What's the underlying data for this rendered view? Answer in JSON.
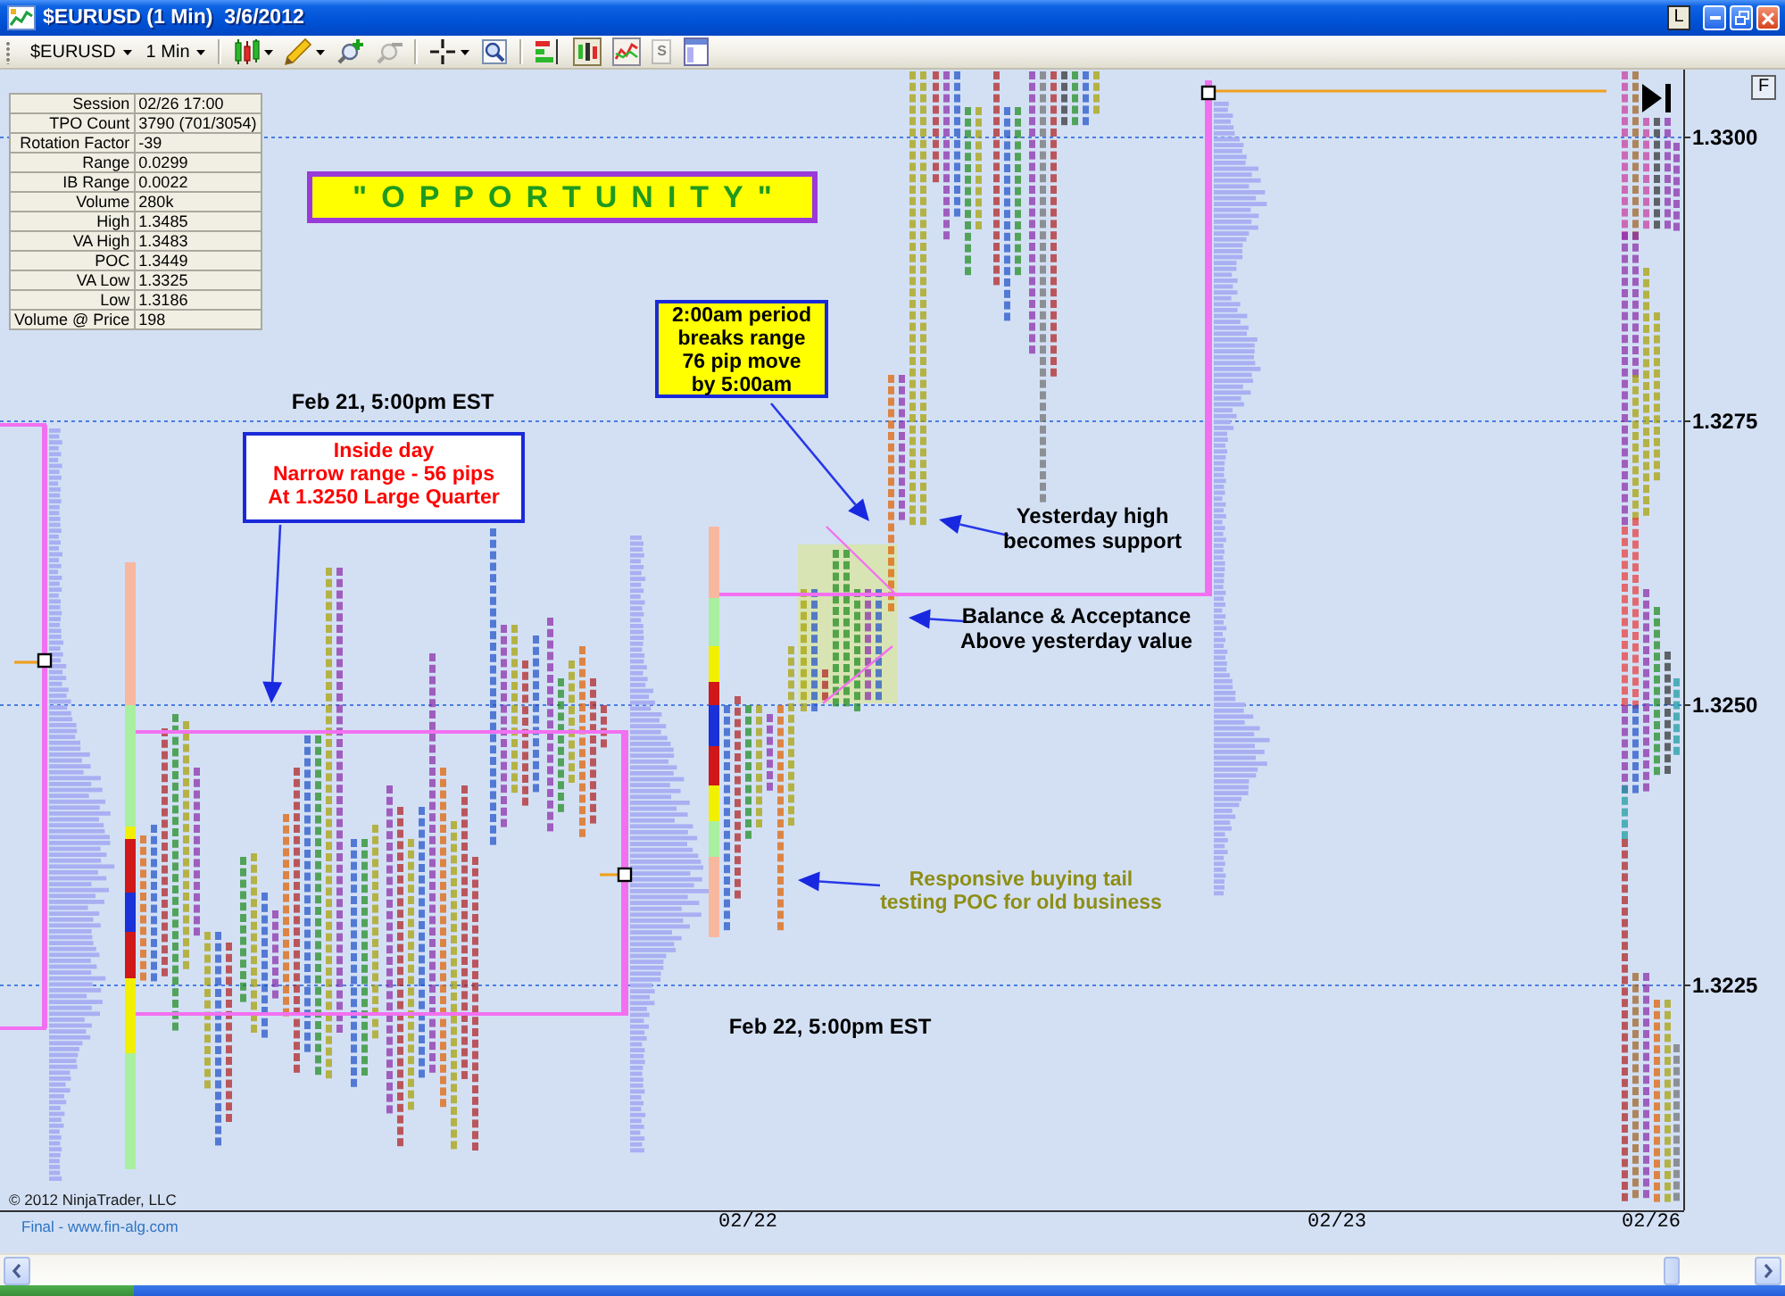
{
  "window": {
    "title": "$EURUSD (1 Min)  3/6/2012",
    "controls": [
      {
        "kind": "link",
        "label": "L"
      },
      {
        "kind": "minimize"
      },
      {
        "kind": "restore"
      },
      {
        "kind": "close"
      }
    ]
  },
  "toolbar": {
    "items": [
      {
        "kind": "dropdown",
        "label": "$EURUSD",
        "disabled": false
      },
      {
        "kind": "dropdown",
        "label": "1 Min",
        "disabled": false
      },
      {
        "kind": "separator"
      },
      {
        "kind": "candles",
        "menu": true,
        "disabled": false
      },
      {
        "kind": "pencil",
        "menu": true,
        "disabled": false
      },
      {
        "kind": "zoom-in",
        "menu": false,
        "disabled": false
      },
      {
        "kind": "zoom-out",
        "menu": false,
        "disabled": true
      },
      {
        "kind": "separator"
      },
      {
        "kind": "crosshair",
        "menu": true,
        "disabled": false
      },
      {
        "kind": "magnifier",
        "menu": false,
        "disabled": false
      },
      {
        "kind": "separator"
      },
      {
        "kind": "indicators",
        "menu": false,
        "disabled": false
      },
      {
        "kind": "bars",
        "menu": false,
        "disabled": false
      },
      {
        "kind": "linechart",
        "menu": false,
        "disabled": false
      },
      {
        "kind": "strategy",
        "label": "S",
        "menu": false,
        "disabled": true
      },
      {
        "kind": "properties",
        "menu": false,
        "disabled": false
      }
    ]
  },
  "chart": {
    "stats": [
      {
        "label": "Session",
        "value": "02/26 17:00"
      },
      {
        "label": "TPO Count",
        "value": "3790 (701/3054)"
      },
      {
        "label": "Rotation Factor",
        "value": "-39"
      },
      {
        "label": "Range",
        "value": "0.0299"
      },
      {
        "label": "IB Range",
        "value": "0.0022"
      },
      {
        "label": "Volume",
        "value": "280k"
      },
      {
        "label": "High",
        "value": "1.3485"
      },
      {
        "label": "VA High",
        "value": "1.3483"
      },
      {
        "label": "POC",
        "value": "1.3449"
      },
      {
        "label": "VA Low",
        "value": "1.3325"
      },
      {
        "label": "Low",
        "value": "1.3186"
      },
      {
        "label": "Volume @ Price",
        "value": "198"
      }
    ],
    "corner_button": "F",
    "annotations": [
      {
        "kind": "banner",
        "lines": [
          "\"OPPORTUNITY\""
        ],
        "arrow": false
      },
      {
        "kind": "highlight",
        "lines": [
          "2:00am period",
          "breaks range",
          "76 pip move",
          "by 5:00am"
        ],
        "arrow": true
      },
      {
        "kind": "date",
        "lines": [
          "Feb 21, 5:00pm EST"
        ],
        "arrow": false
      },
      {
        "kind": "boxed",
        "lines": [
          "Inside day",
          "Narrow range - 56 pips",
          "At 1.3250 Large Quarter"
        ],
        "arrow": true
      },
      {
        "kind": "plain",
        "lines": [
          "Yesterday high",
          "becomes support"
        ],
        "arrow": true
      },
      {
        "kind": "plain",
        "lines": [
          "Balance & Acceptance",
          "Above yesterday value"
        ],
        "arrow": true
      },
      {
        "kind": "muted",
        "lines": [
          "Responsive buying tail",
          "testing POC for old business"
        ],
        "arrow": true
      },
      {
        "kind": "date",
        "lines": [
          "Feb 22, 5:00pm EST"
        ],
        "arrow": false
      }
    ],
    "price_axis": {
      "labels": [
        "1.3300",
        "1.3275",
        "1.3250",
        "1.3225"
      ]
    },
    "copyright": "© 2012 NinjaTrader, LLC",
    "time_axis": {
      "labels": [
        "02/22",
        "02/23",
        "02/26"
      ]
    },
    "footnote": "Final - www.fin-alg.com"
  }
}
